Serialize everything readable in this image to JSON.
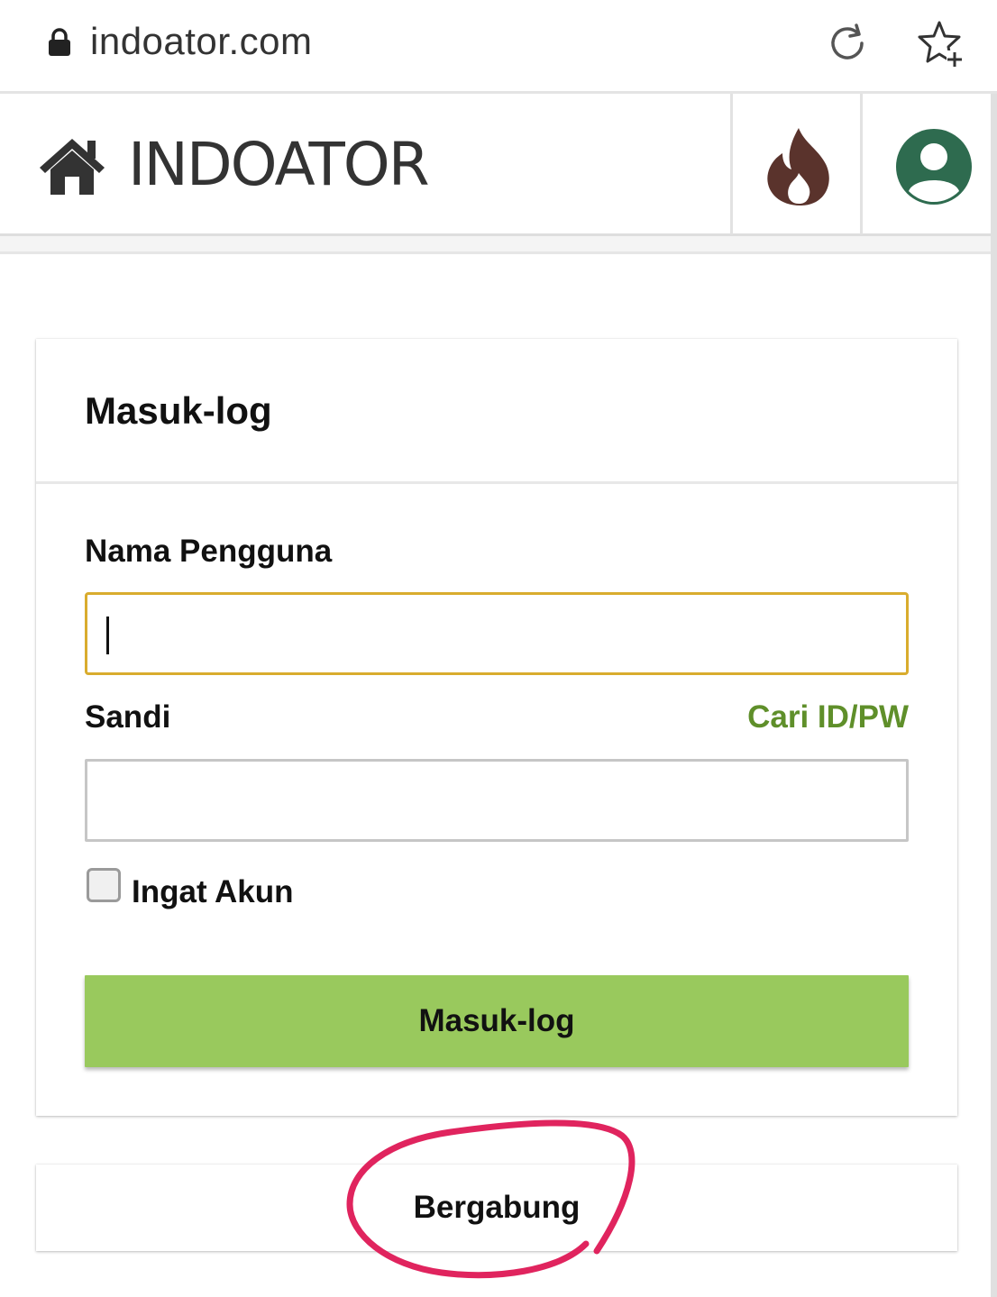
{
  "browser": {
    "url": "indoator.com",
    "icons": [
      "lock-icon",
      "reload-icon",
      "bookmark-star-icon"
    ]
  },
  "header": {
    "site_title": "INDOATOR",
    "icons": [
      "home-icon",
      "fire-icon",
      "account-icon"
    ],
    "colors": {
      "fire": "#5a332c",
      "account": "#2e6b4f"
    }
  },
  "login": {
    "title": "Masuk-log",
    "username_label": "Nama Pengguna",
    "username_value": "",
    "password_label": "Sandi",
    "find_id_link": "Cari ID/PW",
    "password_value": "",
    "remember_label": "Ingat Akun",
    "remember_checked": false,
    "submit_label": "Masuk-log"
  },
  "join": {
    "label": "Bergabung"
  },
  "colors": {
    "accent_green": "#99c95d",
    "link_green": "#5f8f2a",
    "focus_border": "#d9ac2e",
    "annotation": "#e0245e"
  }
}
